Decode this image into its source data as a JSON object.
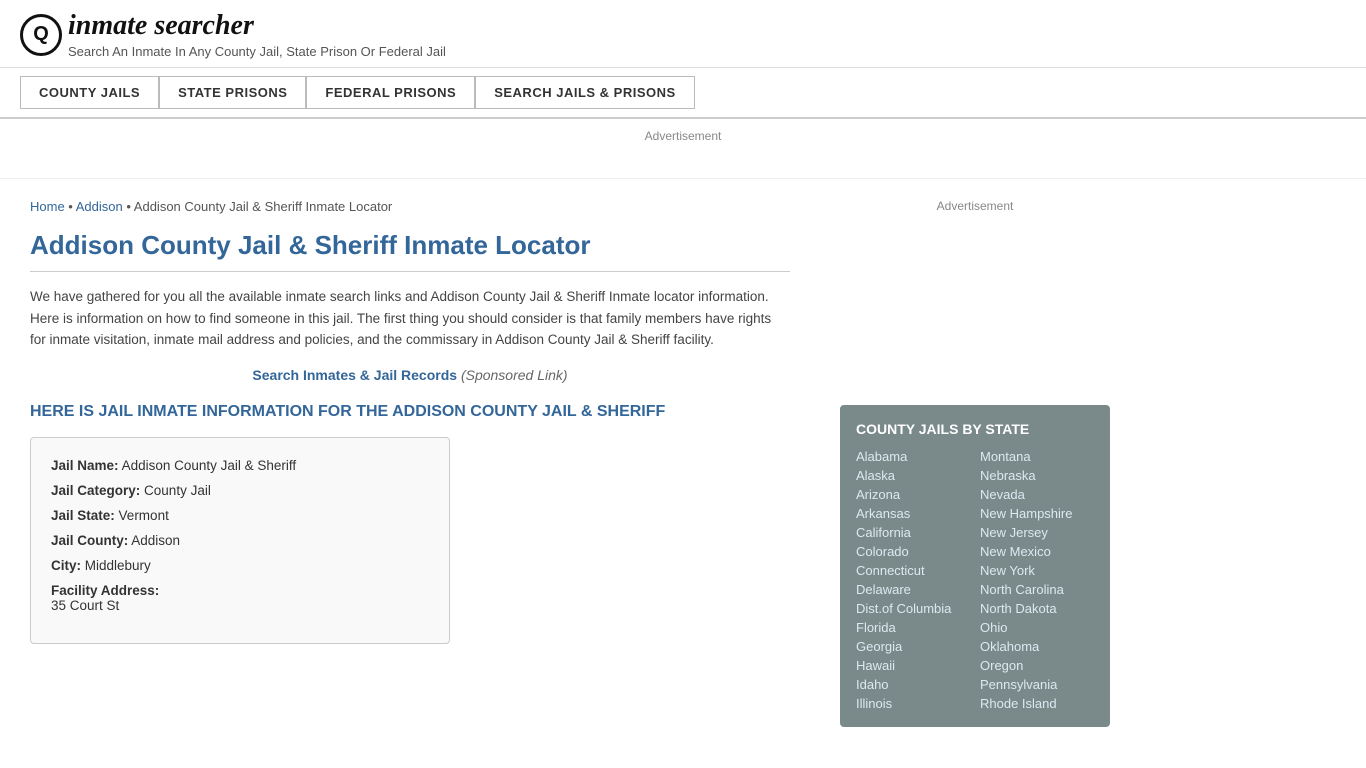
{
  "header": {
    "logo_icon": "Q",
    "logo_text": "inmate searcher",
    "tagline": "Search An Inmate In Any County Jail, State Prison Or Federal Jail"
  },
  "nav": {
    "items": [
      {
        "label": "COUNTY JAILS",
        "id": "county-jails"
      },
      {
        "label": "STATE PRISONS",
        "id": "state-prisons"
      },
      {
        "label": "FEDERAL PRISONS",
        "id": "federal-prisons"
      },
      {
        "label": "SEARCH JAILS & PRISONS",
        "id": "search-jails"
      }
    ]
  },
  "ad_top": "Advertisement",
  "breadcrumb": {
    "home": "Home",
    "addison": "Addison",
    "current": "Addison County Jail & Sheriff Inmate Locator"
  },
  "page": {
    "title": "Addison County Jail & Sheriff Inmate Locator",
    "description": "We have gathered for you all the available inmate search links and Addison County Jail & Sheriff Inmate locator information. Here is information on how to find someone in this jail. The first thing you should consider is that family members have rights for inmate visitation, inmate mail address and policies, and the commissary in Addison County Jail & Sheriff facility.",
    "search_link": "Search Inmates & Jail Records",
    "sponsored": "(Sponsored Link)",
    "inmate_heading": "HERE IS JAIL INMATE INFORMATION FOR THE ADDISON COUNTY JAIL & SHERIFF"
  },
  "info_box": {
    "jail_name_label": "Jail Name:",
    "jail_name_value": "Addison County Jail & Sheriff",
    "jail_category_label": "Jail Category:",
    "jail_category_value": "County Jail",
    "jail_state_label": "Jail State:",
    "jail_state_value": "Vermont",
    "jail_county_label": "Jail County:",
    "jail_county_value": "Addison",
    "city_label": "City:",
    "city_value": "Middlebury",
    "facility_address_label": "Facility Address:",
    "facility_address_value": "35 Court St"
  },
  "sidebar": {
    "ad_label": "Advertisement",
    "state_box_title": "COUNTY JAILS BY STATE",
    "states_left": [
      "Alabama",
      "Alaska",
      "Arizona",
      "Arkansas",
      "California",
      "Colorado",
      "Connecticut",
      "Delaware",
      "Dist.of Columbia",
      "Florida",
      "Georgia",
      "Hawaii",
      "Idaho",
      "Illinois"
    ],
    "states_right": [
      "Montana",
      "Nebraska",
      "Nevada",
      "New Hampshire",
      "New Jersey",
      "New Mexico",
      "New York",
      "North Carolina",
      "North Dakota",
      "Ohio",
      "Oklahoma",
      "Oregon",
      "Pennsylvania",
      "Rhode Island"
    ]
  }
}
